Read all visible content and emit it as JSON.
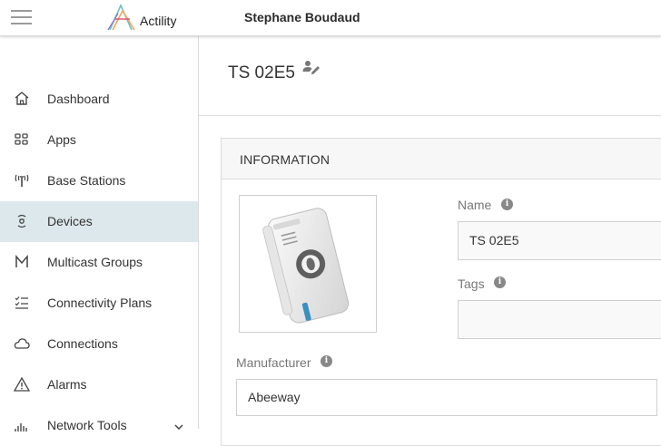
{
  "header": {
    "brand": "Actility",
    "user": "Stephane Boudaud"
  },
  "sidebar": {
    "items": [
      {
        "label": "Dashboard",
        "icon": "home-icon"
      },
      {
        "label": "Apps",
        "icon": "apps-grid-icon"
      },
      {
        "label": "Base Stations",
        "icon": "antenna-icon"
      },
      {
        "label": "Devices",
        "icon": "device-icon",
        "active": true
      },
      {
        "label": "Multicast Groups",
        "icon": "multicast-icon"
      },
      {
        "label": "Connectivity Plans",
        "icon": "checklist-icon"
      },
      {
        "label": "Connections",
        "icon": "cloud-icon"
      },
      {
        "label": "Alarms",
        "icon": "warning-icon"
      },
      {
        "label": "Network Tools",
        "icon": "signal-bars-icon"
      }
    ]
  },
  "page": {
    "title": "TS 02E5"
  },
  "info_card": {
    "title": "INFORMATION",
    "name_label": "Name",
    "name_value": "TS 02E5",
    "tags_label": "Tags",
    "tags_value": "",
    "manufacturer_label": "Manufacturer",
    "manufacturer_value": "Abeeway",
    "info_glyph": "i"
  },
  "colors": {
    "active_nav_bg": "#dde8ec",
    "accent_blue": "#3a8fc1"
  }
}
